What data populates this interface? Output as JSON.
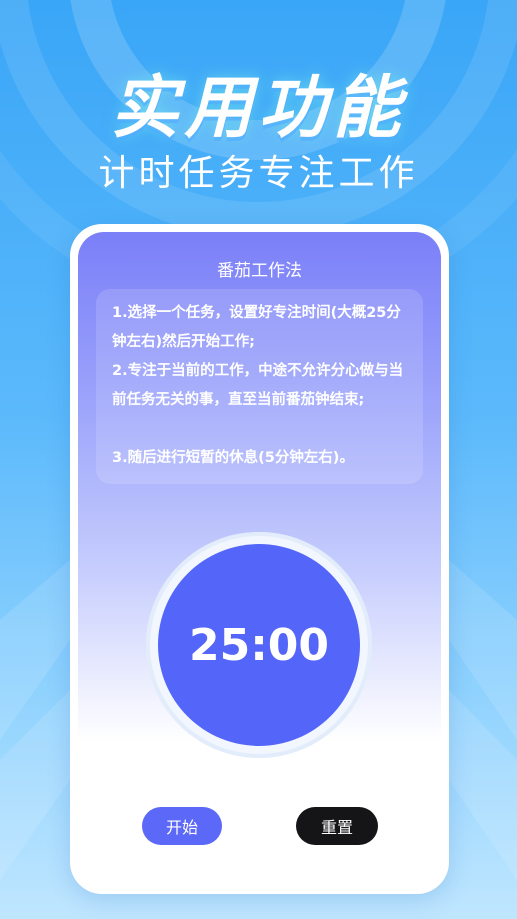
{
  "hero": {
    "title": "实用功能",
    "subtitle": "计时任务专注工作"
  },
  "card": {
    "title": "番茄工作法",
    "steps": [
      "1.选择一个任务，设置好专注时间(大概25分钟左右)然后开始工作;",
      "2.专注于当前的工作，中途不允许分心做与当前任务无关的事，直至当前番茄钟结束;",
      "3.随后进行短暂的休息(5分钟左右)。"
    ],
    "timer": "25:00",
    "start_label": "开始",
    "reset_label": "重置"
  },
  "colors": {
    "accent": "#5465f9",
    "reset_button": "#151518",
    "background": "#3aa6f7"
  }
}
